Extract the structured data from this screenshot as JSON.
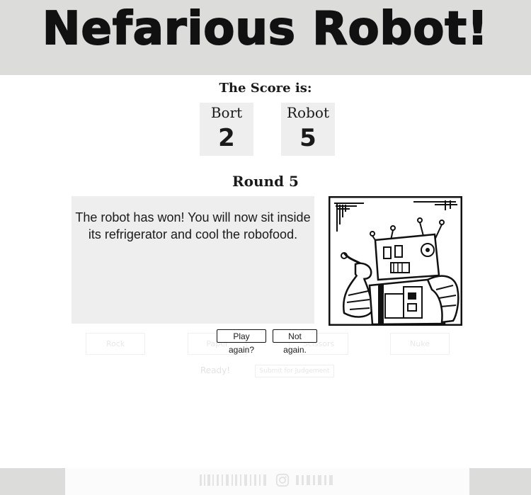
{
  "header": {
    "title": "Nefarious Robot!"
  },
  "score": {
    "heading": "The Score is:",
    "players": [
      {
        "name": "Bort",
        "value": "2"
      },
      {
        "name": "Robot",
        "value": "5"
      }
    ]
  },
  "round": {
    "label": "Round 5"
  },
  "message": {
    "text": "The robot has won! You will now sit inside its refrigerator and cool the robofood."
  },
  "faded_choices": [
    "Rock",
    "Paper",
    "Scissors",
    "Nuke"
  ],
  "faded_ready": "Ready!",
  "faded_submit": "Submit for Judgement",
  "buttons": {
    "play_again": "Play again?",
    "not_again": "Not again."
  },
  "colors": {
    "header_bg": "#dcdddb",
    "panel_bg": "#eeeeee"
  }
}
